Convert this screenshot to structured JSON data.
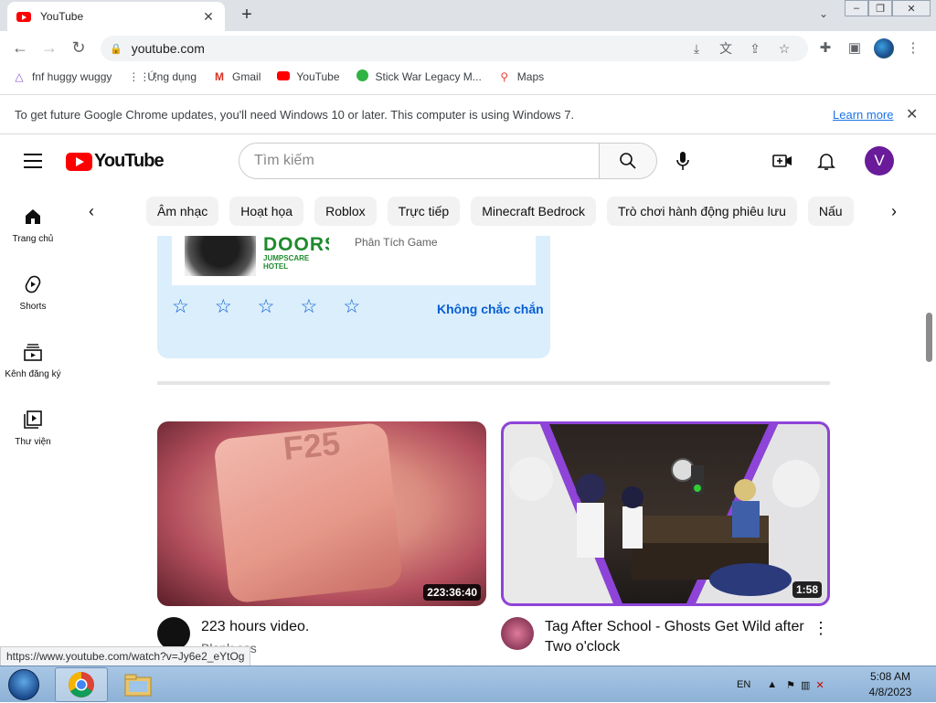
{
  "browser": {
    "tab_title": "YouTube",
    "tab_close": "✕",
    "new_tab": "+",
    "url": "youtube.com",
    "window_controls": [
      "minimize",
      "restore",
      "close"
    ]
  },
  "bookmarks": [
    {
      "label": "fnf huggy wuggy",
      "icon": "triangle-icon"
    },
    {
      "label": "Ứng dụng",
      "icon": "apps-grid-icon"
    },
    {
      "label": "Gmail",
      "icon": "gmail-icon"
    },
    {
      "label": "YouTube",
      "icon": "youtube-icon"
    },
    {
      "label": "Stick War Legacy M...",
      "icon": "game-icon"
    },
    {
      "label": "Maps",
      "icon": "maps-pin-icon"
    }
  ],
  "infobar": {
    "message": "To get future Google Chrome updates, you'll need Windows 10 or later. This computer is using Windows 7.",
    "learn_more": "Learn more",
    "close": "✕"
  },
  "header": {
    "logo_text": "YouTube",
    "search_placeholder": "Tìm kiếm",
    "avatar_letter": "V",
    "avatar_color": "#6a1b9a"
  },
  "chips": [
    "Âm nhạc",
    "Hoạt họa",
    "Roblox",
    "Trực tiếp",
    "Minecraft Bedrock",
    "Trò chơi hành động phiêu lưu",
    "Nấu"
  ],
  "sidebar": [
    {
      "label": "Trang chủ",
      "icon": "home-icon"
    },
    {
      "label": "Shorts",
      "icon": "shorts-icon"
    },
    {
      "label": "Kênh đăng ký",
      "icon": "subscriptions-icon"
    },
    {
      "label": "Thư viện",
      "icon": "library-icon"
    }
  ],
  "survey": {
    "thumb_word": "DOORS",
    "thumb_sub": "JUMPSCARE HOTEL",
    "channel": "Phân Tích Game",
    "stars": 5,
    "unsure_label": "Không chắc chắn"
  },
  "videos": [
    {
      "title": "223 hours video.",
      "channel": "Blank ess",
      "duration": "223:36:40"
    },
    {
      "title": "Tag After School - Ghosts Get Wild after Two o'clock",
      "channel": "",
      "duration": "1:58",
      "more": "⋮"
    }
  ],
  "status_url": "https://www.youtube.com/watch?v=Jy6e2_eYtOg",
  "taskbar": {
    "language": "EN",
    "time": "5:08 AM",
    "date": "4/8/2023"
  },
  "colors": {
    "brand_red": "#ff0000",
    "link_blue": "#065fd4",
    "chrome_blue": "#1a73e8",
    "survey_bg": "#dbeefc"
  }
}
